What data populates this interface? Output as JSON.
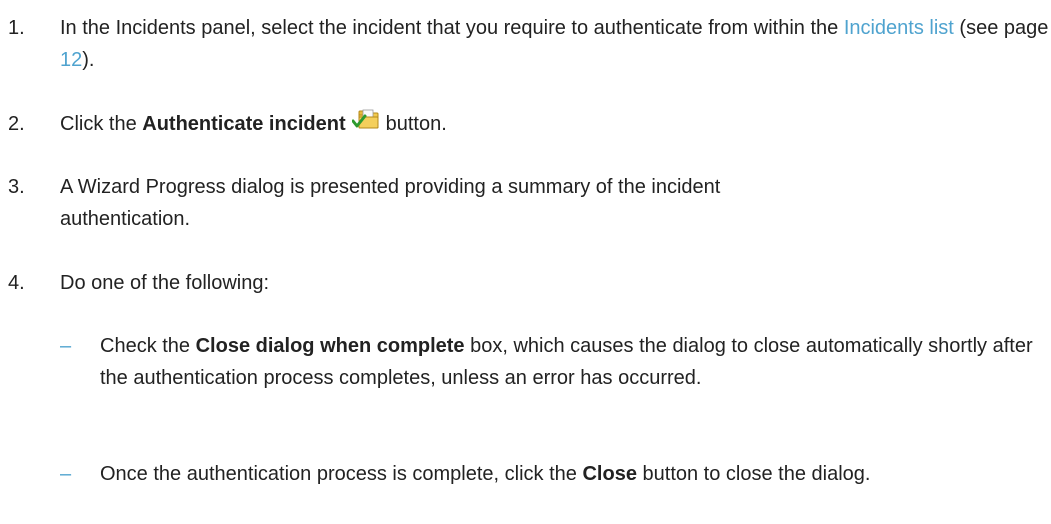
{
  "steps": [
    {
      "number": "1.",
      "text_before": "In the Incidents panel, select the incident that you require to authenticate from within the ",
      "link_text": "Incidents list",
      "text_mid": " (see page ",
      "page_link": "12",
      "text_after": ")."
    },
    {
      "number": "2.",
      "text_before": "Click the ",
      "bold": "Authenticate incident",
      "icon": "authenticate-incident-icon",
      "text_after": "button."
    },
    {
      "number": "3.",
      "text": "A Wizard Progress dialog is presented providing a summary of the incident authentication."
    },
    {
      "number": "4.",
      "text": "Do one of the following:"
    }
  ],
  "sub_items": [
    {
      "bullet": "–",
      "text_before": "Check the ",
      "bold": "Close dialog when complete",
      "text_after": " box, which causes the dialog to close automatically shortly after the authentication process completes, unless an error has occurred."
    },
    {
      "bullet": "–",
      "text_before": "Once the authentication process is complete, click the ",
      "bold": "Close",
      "text_after": " button to close the dialog."
    }
  ],
  "colors": {
    "link": "#4fa3cf",
    "text": "#222222"
  }
}
